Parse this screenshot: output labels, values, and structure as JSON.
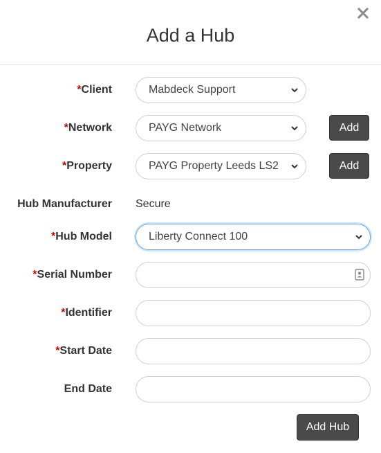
{
  "modal": {
    "title": "Add a Hub",
    "close_icon": "close-icon",
    "required_marker": "*"
  },
  "form": {
    "client": {
      "label": "Client",
      "value": "Mabdeck Support"
    },
    "network": {
      "label": "Network",
      "value": "PAYG Network",
      "add_label": "Add"
    },
    "property": {
      "label": "Property",
      "value": "PAYG Property Leeds LS2",
      "add_label": "Add"
    },
    "hub_manufacturer": {
      "label": "Hub Manufacturer",
      "value": "Secure"
    },
    "hub_model": {
      "label": "Hub Model",
      "value": "Liberty Connect 100"
    },
    "serial_number": {
      "label": "Serial Number",
      "value": "",
      "icon": "contact-card-icon"
    },
    "identifier": {
      "label": "Identifier",
      "value": ""
    },
    "start_date": {
      "label": "Start Date",
      "value": ""
    },
    "end_date": {
      "label": "End Date",
      "value": ""
    }
  },
  "actions": {
    "submit_label": "Add Hub"
  },
  "colors": {
    "required": "#cc0000",
    "button_bg": "#4a4a4a",
    "focus_border": "#6fa8dc"
  }
}
